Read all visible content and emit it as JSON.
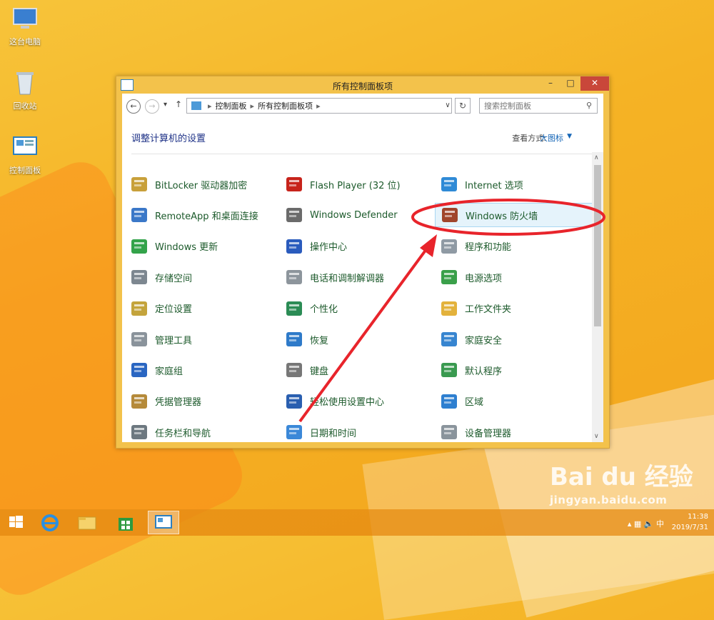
{
  "desktop": {
    "icons": [
      {
        "label": "这台电脑"
      },
      {
        "label": "回收站"
      },
      {
        "label": "控制面板"
      }
    ]
  },
  "window": {
    "title": "所有控制面板项",
    "buttons": {
      "minimize": "–",
      "maximize": "□",
      "close": "✕"
    }
  },
  "nav": {
    "breadcrumb": [
      "控制面板",
      "所有控制面板项"
    ],
    "search_placeholder": "搜索控制面板"
  },
  "header": {
    "title": "调整计算机的设置",
    "view_by_label": "查看方式:",
    "view_by_value": "大图标"
  },
  "items": [
    {
      "label": "BitLocker 驱动器加密",
      "icon": "bitlocker-icon",
      "selected": false
    },
    {
      "label": "Flash Player (32 位)",
      "icon": "flash-player-icon",
      "selected": false
    },
    {
      "label": "Internet 选项",
      "icon": "internet-options-icon",
      "selected": false
    },
    {
      "label": "RemoteApp 和桌面连接",
      "icon": "remoteapp-icon",
      "selected": false
    },
    {
      "label": "Windows Defender",
      "icon": "windows-defender-icon",
      "selected": false
    },
    {
      "label": "Windows 防火墙",
      "icon": "firewall-icon",
      "selected": true
    },
    {
      "label": "Windows 更新",
      "icon": "windows-update-icon",
      "selected": false
    },
    {
      "label": "操作中心",
      "icon": "action-center-flag-icon",
      "selected": false
    },
    {
      "label": "程序和功能",
      "icon": "programs-features-icon",
      "selected": false
    },
    {
      "label": "存储空间",
      "icon": "storage-spaces-icon",
      "selected": false
    },
    {
      "label": "电话和调制解调器",
      "icon": "phone-modem-icon",
      "selected": false
    },
    {
      "label": "电源选项",
      "icon": "power-options-icon",
      "selected": false
    },
    {
      "label": "定位设置",
      "icon": "location-settings-icon",
      "selected": false
    },
    {
      "label": "个性化",
      "icon": "personalization-icon",
      "selected": false
    },
    {
      "label": "工作文件夹",
      "icon": "work-folders-icon",
      "selected": false
    },
    {
      "label": "管理工具",
      "icon": "admin-tools-icon",
      "selected": false
    },
    {
      "label": "恢复",
      "icon": "recovery-icon",
      "selected": false
    },
    {
      "label": "家庭安全",
      "icon": "family-safety-icon",
      "selected": false
    },
    {
      "label": "家庭组",
      "icon": "homegroup-icon",
      "selected": false
    },
    {
      "label": "键盘",
      "icon": "keyboard-icon",
      "selected": false
    },
    {
      "label": "默认程序",
      "icon": "default-programs-icon",
      "selected": false
    },
    {
      "label": "凭据管理器",
      "icon": "credential-manager-icon",
      "selected": false
    },
    {
      "label": "轻松使用设置中心",
      "icon": "ease-of-access-icon",
      "selected": false
    },
    {
      "label": "区域",
      "icon": "region-icon",
      "selected": false
    },
    {
      "label": "任务栏和导航",
      "icon": "taskbar-navigation-icon",
      "selected": false
    },
    {
      "label": "日期和时间",
      "icon": "date-time-icon",
      "selected": false
    },
    {
      "label": "设备管理器",
      "icon": "device-manager-icon",
      "selected": false
    }
  ],
  "taskbar": {
    "time": "11:38",
    "date": "2019/7/31",
    "ime": "中"
  },
  "watermark": {
    "brand": "Bai du 经验",
    "url": "jingyan.baidu.com"
  },
  "colors": {
    "accent": "#1566b7",
    "item_text": "#1c5a2b",
    "header_title": "#1e3287",
    "annotation": "#e8242b"
  }
}
